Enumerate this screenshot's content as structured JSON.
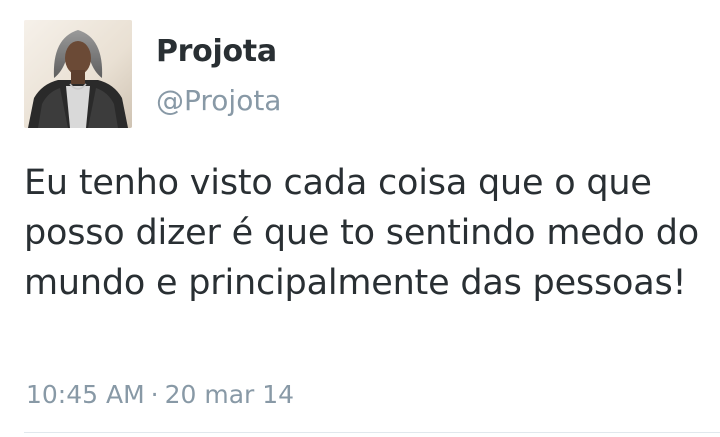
{
  "tweet": {
    "display_name": "Projota",
    "username": "@Projota",
    "text": "Eu tenho visto cada coisa que o que posso dizer é que to sentindo medo do mundo e principalmente das pessoas!",
    "time": "10:45 AM",
    "separator": "·",
    "date": "20 mar 14"
  },
  "icons": {
    "avatar": "profile-photo-avatar"
  },
  "colors": {
    "name": "#292f33",
    "secondary": "#8899a6",
    "divider": "#e1e8ed"
  }
}
